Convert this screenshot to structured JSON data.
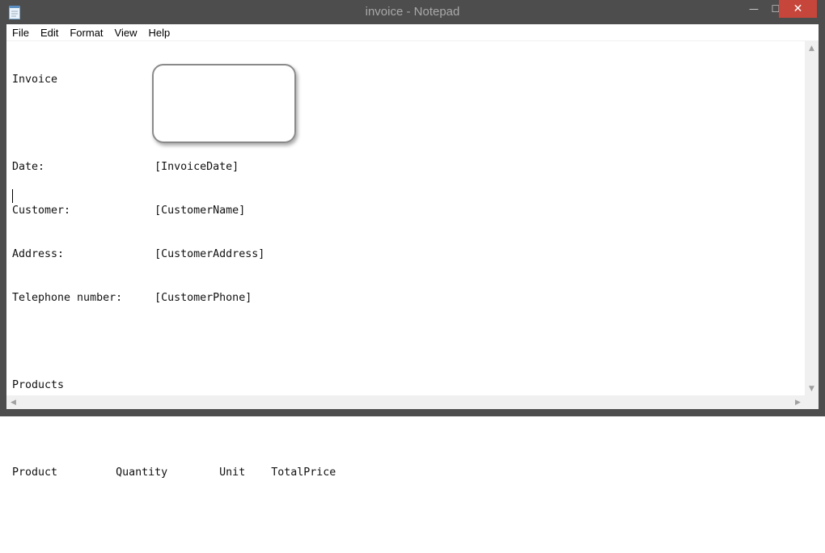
{
  "window": {
    "title": "invoice - Notepad",
    "icon": "notepad-icon",
    "minimize_glyph": "—",
    "maximize_glyph": "☐",
    "close_glyph": "✕"
  },
  "menu": {
    "items": [
      "File",
      "Edit",
      "Format",
      "View",
      "Help"
    ]
  },
  "document": {
    "lines": [
      "Invoice",
      "",
      "Date:                 [InvoiceDate]",
      "Customer:             [CustomerName]",
      "Address:              [CustomerAddress]",
      "Telephone number:     [CustomerPhone]",
      "",
      "Products",
      "",
      "Product         Quantity        Unit    TotalPrice",
      ""
    ]
  },
  "scrollbars": {
    "up_glyph": "▲",
    "down_glyph": "▼",
    "left_glyph": "◀",
    "right_glyph": "▶"
  },
  "colors": {
    "titlebar": "#4d4d4d",
    "close_button": "#c7463b",
    "highlight_border": "#8a8a8a"
  }
}
